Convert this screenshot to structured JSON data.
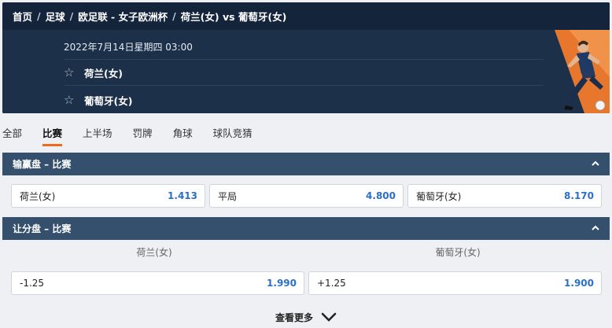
{
  "breadcrumb": [
    "首页",
    "足球",
    "欧足联 - 女子欧洲杯",
    "荷兰(女) vs 葡萄牙(女)"
  ],
  "match": {
    "datetime": "2022年7月14日星期四 03:00",
    "home": "荷兰(女)",
    "away": "葡萄牙(女)"
  },
  "tabs": [
    "全部",
    "比赛",
    "上半场",
    "罚牌",
    "角球",
    "球队竞猜"
  ],
  "active_tab": "比赛",
  "moneyline": {
    "title": "输赢盘 – 比赛",
    "options": [
      {
        "label": "荷兰(女)",
        "odds": "1.413"
      },
      {
        "label": "平局",
        "odds": "4.800"
      },
      {
        "label": "葡萄牙(女)",
        "odds": "8.170"
      }
    ]
  },
  "handicap": {
    "title": "让分盘 – 比赛",
    "home_header": "荷兰(女)",
    "away_header": "葡萄牙(女)",
    "options": [
      {
        "label": "-1.25",
        "odds": "1.990"
      },
      {
        "label": "+1.25",
        "odds": "1.900"
      }
    ]
  },
  "see_more": "查看更多",
  "colors": {
    "header_dark": "#13243b",
    "header_panel": "#1d3049",
    "section_bar": "#34506d",
    "accent": "#f06a1a",
    "odds_blue": "#2a6fc9"
  }
}
